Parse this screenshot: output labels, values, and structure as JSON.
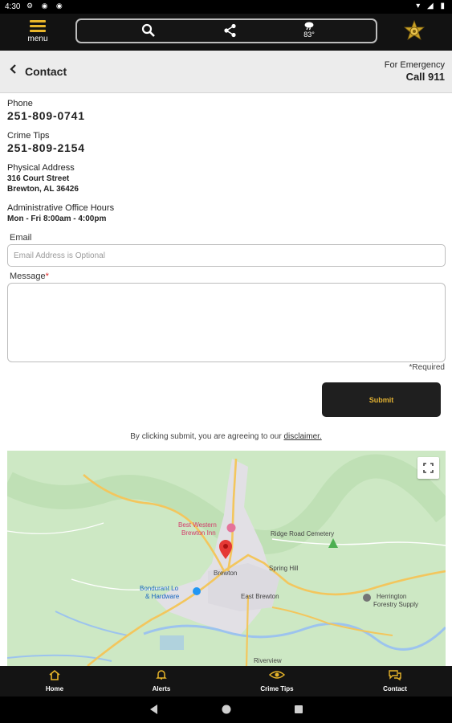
{
  "status_bar": {
    "time": "4:30",
    "notif_icons": "⚙ ◉ ◉",
    "sys_icons": "▾ ◢ ▮"
  },
  "top_bar": {
    "menu_label": "menu",
    "temperature": "83°"
  },
  "header": {
    "title": "Contact",
    "emergency_label": "For Emergency",
    "emergency_action": "Call 911"
  },
  "contact": {
    "phone_label": "Phone",
    "phone": "251-809-0741",
    "tips_label": "Crime Tips",
    "tips": "251-809-2154",
    "address_label": "Physical Address",
    "address_line1": "316 Court Street",
    "address_line2": "Brewton, AL 36426",
    "hours_label": "Administrative Office Hours",
    "hours": "Mon - Fri 8:00am - 4:00pm"
  },
  "form": {
    "email_label": "Email",
    "email_placeholder": "Email Address is Optional",
    "email_value": "",
    "message_label": "Message",
    "message_required_mark": "*",
    "message_value": "",
    "required_note": "*Required",
    "submit_label": "Submit",
    "agree_text": "By clicking submit, you are agreeing to our ",
    "disclaimer_link": "disclaimer."
  },
  "map": {
    "labels": {
      "best_western_1": "Best Western",
      "best_western_2": "Brewton Inn",
      "ridge_road": "Ridge Road Cemetery",
      "brewton": "Brewton",
      "spring_hill": "Spring Hill",
      "bondurant_1": "Bondurant Lo",
      "bondurant_2": "& Hardware",
      "east_brewton": "East Brewton",
      "herrington_1": "Herrington",
      "herrington_2": "Forestry Supply",
      "riverview": "Riverview"
    },
    "colors": {
      "land": "#cde8c4",
      "water": "#9cc3ee",
      "road": "#f3c65d",
      "city": "#e2e0e5",
      "pin": "#e53935"
    }
  },
  "tabs": [
    {
      "label": "Home",
      "icon": "home-icon"
    },
    {
      "label": "Alerts",
      "icon": "bell-icon"
    },
    {
      "label": "Crime Tips",
      "icon": "eye-icon"
    },
    {
      "label": "Contact",
      "icon": "chat-icon"
    }
  ],
  "colors": {
    "accent": "#e8b52a",
    "bar": "#141414"
  }
}
